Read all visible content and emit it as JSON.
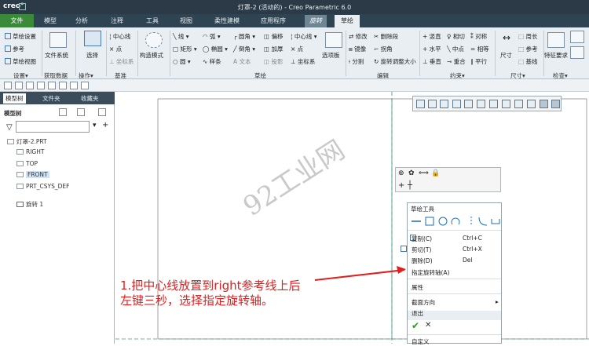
{
  "window": {
    "logo": "creo°",
    "title": "灯罩-2 (活动的) - Creo Parametric 6.0"
  },
  "menu": {
    "file": "文件",
    "tabs": [
      "模型",
      "分析",
      "注释",
      "工具",
      "视图",
      "柔性建模",
      "应用程序"
    ],
    "context_tab": "旋转",
    "active_tab": "草绘"
  },
  "ribbon": {
    "setup": {
      "sketch_setup": "草绘设置",
      "reference": "参考",
      "sketch_view": "草绘视图",
      "label": "设置▾"
    },
    "get_data": {
      "file_system": "文件系统",
      "label": "获取数据"
    },
    "operations": {
      "select": "选择",
      "label": "操作▾"
    },
    "datum": {
      "centerline": "中心线",
      "point": "点",
      "coord": "坐标系",
      "label": "基准"
    },
    "construction": {
      "mode": "构造模式"
    },
    "sketch": {
      "line": "线 ▾",
      "rect": "矩形 ▾",
      "circle": "圆 ▾",
      "arc": "弧 ▾",
      "ellipse": "椭圆 ▾",
      "spline": "样条",
      "fillet": "圆角 ▾",
      "chamfer": "倒角 ▾",
      "text": "文本",
      "offset": "偏移",
      "thicken": "加厚",
      "project": "投影",
      "centerline2": "中心线 ▾",
      "point2": "点",
      "coord2": "坐标系",
      "palette": "选项板",
      "label": "草绘"
    },
    "editing": {
      "modify": "修改",
      "delete_seg": "删除段",
      "mirror": "镜像",
      "corner": "拐角",
      "divide": "分割",
      "rotate_resize": "旋转调整大小",
      "label": "编辑"
    },
    "constrain": {
      "vertical": "竖直",
      "horizontal": "水平",
      "perpendicular": "垂直",
      "tangent": "相切",
      "midpoint": "中点",
      "coincident": "重合",
      "symmetric": "对称",
      "equal": "相等",
      "parallel": "平行",
      "label": "约束▾"
    },
    "dimension": {
      "dim": "尺寸",
      "perimeter": "周长",
      "reference": "参考",
      "baseline": "基线",
      "label": "尺寸▾"
    },
    "inspect": {
      "feature_req": "特征要求",
      "label": "检查▾"
    }
  },
  "left_panel": {
    "tabs": [
      "模型树",
      "文件夹",
      "收藏夹"
    ],
    "header": "模型树",
    "tree": [
      "灯罩-2.PRT",
      "RIGHT",
      "TOP",
      "FRONT",
      "PRT_CSYS_DEF",
      "旋转 1"
    ]
  },
  "context_menu": {
    "title": "草绘工具",
    "items": [
      {
        "label": "复制(C)",
        "shortcut": "Ctrl+C"
      },
      {
        "label": "剪切(T)",
        "shortcut": "Ctrl+X"
      },
      {
        "label": "删除(D)",
        "shortcut": "Del"
      },
      {
        "label": "指定旋转轴(A)",
        "shortcut": ""
      },
      {
        "label": "属性",
        "shortcut": ""
      },
      {
        "label": "截面方向",
        "shortcut": "▸"
      },
      {
        "label": "退出",
        "shortcut": ""
      },
      {
        "label": "自定义",
        "shortcut": ""
      }
    ]
  },
  "annotation": {
    "line1": "1.把中心线放置到right参考线上后",
    "line2": "左键三秒，选择指定旋转轴。"
  },
  "watermark": "92工业网",
  "colors": {
    "title_bg": "#2b3a46",
    "file_tab": "#3a8a3a",
    "annotation": "#e02020",
    "ribbon_bg": "#e9eef2"
  }
}
